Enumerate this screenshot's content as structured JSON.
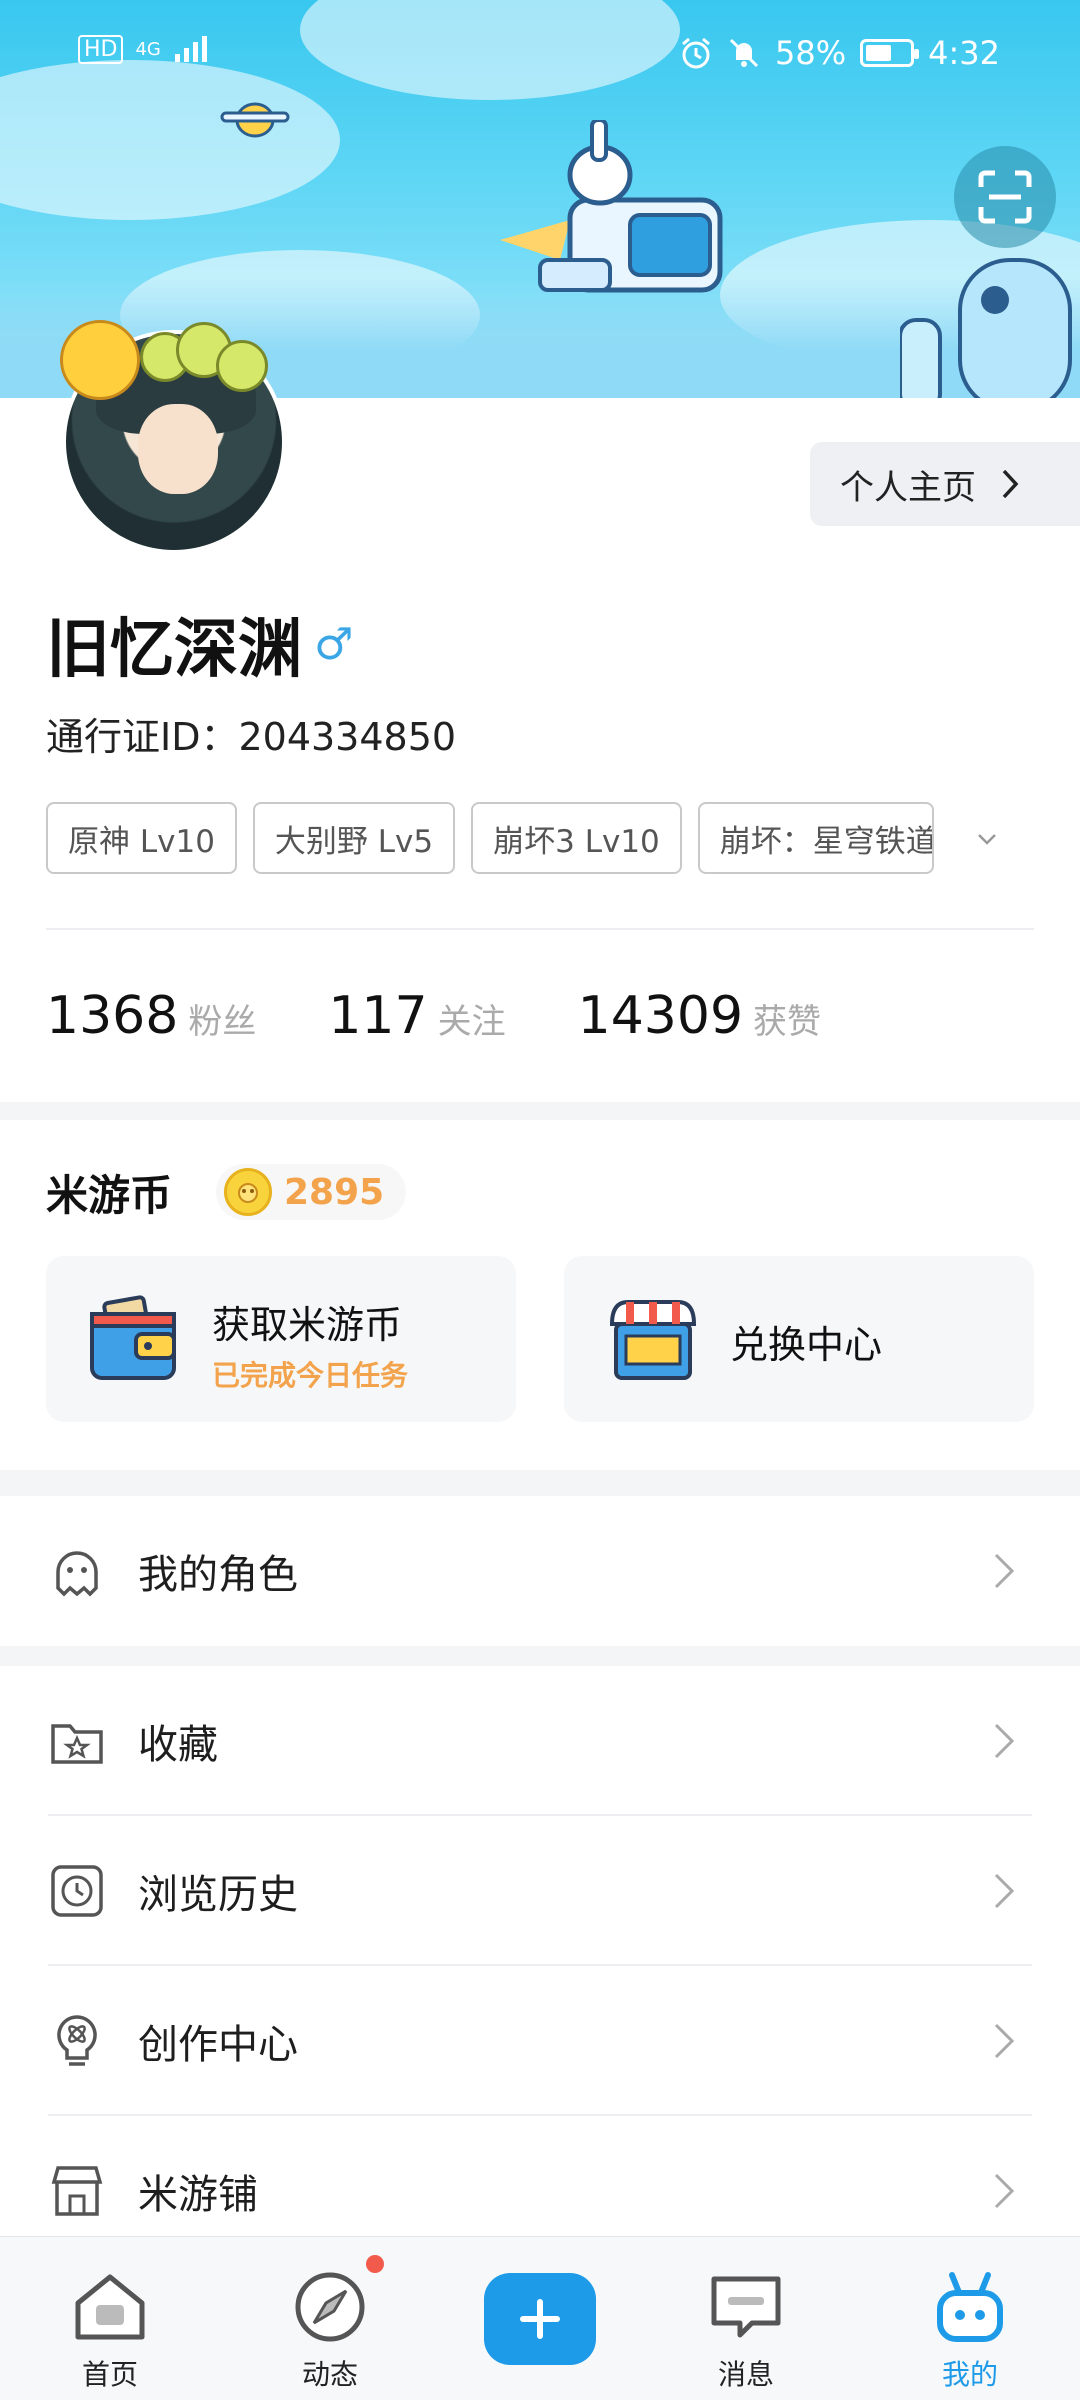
{
  "status_bar": {
    "network_left": "HD",
    "network_type": "4G",
    "battery_percent": "58%",
    "battery_level": 0.58,
    "time": "4:32"
  },
  "profile": {
    "homepage_label": "个人主页",
    "username": "旧忆深渊",
    "gender_symbol": "♂",
    "passport_id": "通行证ID：204334850",
    "game_tags": [
      "原神  Lv10",
      "大别野  Lv5",
      "崩坏3  Lv10",
      "崩坏：星穹铁道"
    ],
    "stats": [
      {
        "value": "1368",
        "label": "粉丝"
      },
      {
        "value": "117",
        "label": "关注"
      },
      {
        "value": "14309",
        "label": "获赞"
      }
    ]
  },
  "coins": {
    "title": "米游币",
    "balance": "2895",
    "earn": {
      "title": "获取米游币",
      "subtitle": "已完成今日任务"
    },
    "exchange": {
      "title": "兑换中心"
    }
  },
  "menu": {
    "characters": "我的角色",
    "favorites": "收藏",
    "history": "浏览历史",
    "creator": "创作中心",
    "shop": "米游铺"
  },
  "bottom_nav": {
    "home": "首页",
    "feed": "动态",
    "messages": "消息",
    "mine": "我的"
  },
  "colors": {
    "accent": "#1e9be8",
    "coin_orange": "#f3a34c",
    "badge_red": "#f25a4b"
  }
}
